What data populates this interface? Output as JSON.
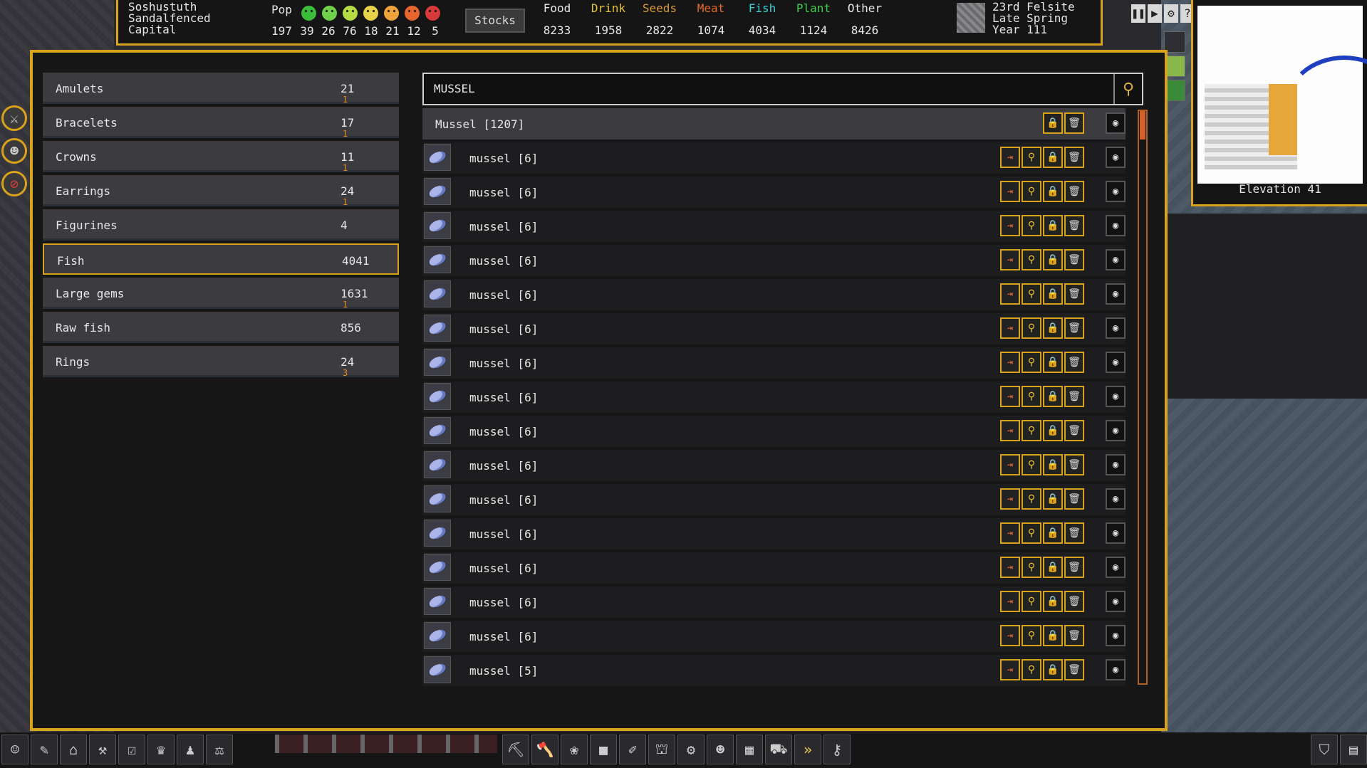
{
  "fortress": {
    "name": "Soshustuth",
    "civ": "Sandalfenced",
    "status": "Capital"
  },
  "population": {
    "label": "Pop",
    "total": "197",
    "moods": [
      {
        "icon": "ecstatic-face-icon",
        "color": "#3bbd3b",
        "count": "39"
      },
      {
        "icon": "happy-face-icon",
        "color": "#6fd04a",
        "count": "26"
      },
      {
        "icon": "content-face-icon",
        "color": "#b6dc45",
        "count": "76"
      },
      {
        "icon": "neutral-face-icon",
        "color": "#e8d24a",
        "count": "18"
      },
      {
        "icon": "unhappy-face-icon",
        "color": "#f0a23a",
        "count": "21"
      },
      {
        "icon": "miserable-face-icon",
        "color": "#e8652f",
        "count": "12"
      },
      {
        "icon": "angry-face-icon",
        "color": "#d83a3a",
        "count": "5"
      }
    ]
  },
  "stocks_button": "Stocks",
  "stock_categories": [
    {
      "label": "Food",
      "value": "8233",
      "color": "#e8e8e8"
    },
    {
      "label": "Drink",
      "value": "1958",
      "color": "#e6c233"
    },
    {
      "label": "Seeds",
      "value": "2822",
      "color": "#d69a3a"
    },
    {
      "label": "Meat",
      "value": "1074",
      "color": "#e86a2a"
    },
    {
      "label": "Fish",
      "value": "4034",
      "color": "#3ed0d8"
    },
    {
      "label": "Plant",
      "value": "1124",
      "color": "#3ed04a"
    },
    {
      "label": "Other",
      "value": "8426",
      "color": "#e8e8e8"
    }
  ],
  "date": {
    "day": "23rd Felsite",
    "season": "Late Spring",
    "year": "Year 111"
  },
  "minimap": {
    "elevation": "Elevation 41"
  },
  "categories": [
    {
      "label": "Amulets",
      "count": "21",
      "sub": "1"
    },
    {
      "label": "Bracelets",
      "count": "17",
      "sub": "1"
    },
    {
      "label": "Crowns",
      "count": "11",
      "sub": "1"
    },
    {
      "label": "Earrings",
      "count": "24",
      "sub": "1"
    },
    {
      "label": "Figurines",
      "count": "4",
      "sub": ""
    },
    {
      "label": "Fish",
      "count": "4041",
      "sub": "",
      "selected": true
    },
    {
      "label": "Large gems",
      "count": "1631",
      "sub": "1"
    },
    {
      "label": "Raw fish",
      "count": "856",
      "sub": ""
    },
    {
      "label": "Rings",
      "count": "24",
      "sub": "3"
    }
  ],
  "search": {
    "value": "MUSSEL"
  },
  "group": {
    "label": "Mussel [1207]"
  },
  "items": [
    "mussel [6]",
    "mussel [6]",
    "mussel [6]",
    "mussel [6]",
    "mussel [6]",
    "mussel [6]",
    "mussel [6]",
    "mussel [6]",
    "mussel [6]",
    "mussel [6]",
    "mussel [6]",
    "mussel [6]",
    "mussel [6]",
    "mussel [6]",
    "mussel [6]",
    "mussel [5]"
  ],
  "colors": {
    "accent": "#d9a21b",
    "panel": "#161616",
    "row": "#3b3b40"
  }
}
